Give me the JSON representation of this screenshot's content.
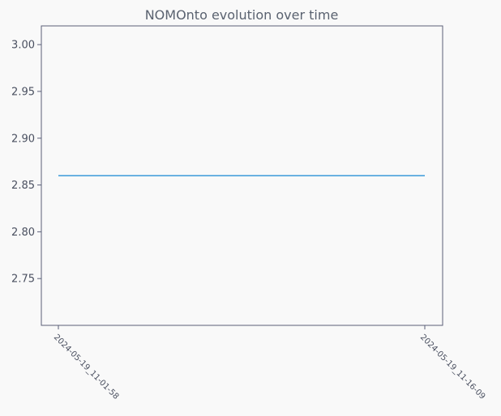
{
  "chart_data": {
    "type": "line",
    "title": "NOMOnto evolution over time",
    "xlabel": "",
    "ylabel": "",
    "x": [
      "2024-05-19_11-01-58",
      "2024-05-19_11-16-09"
    ],
    "series": [
      {
        "values": [
          2.86,
          2.86
        ]
      }
    ],
    "ylim": [
      2.7,
      3.02
    ],
    "yticks": [
      "2.75",
      "2.80",
      "2.85",
      "2.90",
      "2.95",
      "3.00"
    ],
    "grid": false,
    "colors": {
      "line": "#3a9ad9",
      "frame": "#5a5f78",
      "background": "#f9f9f9"
    }
  }
}
